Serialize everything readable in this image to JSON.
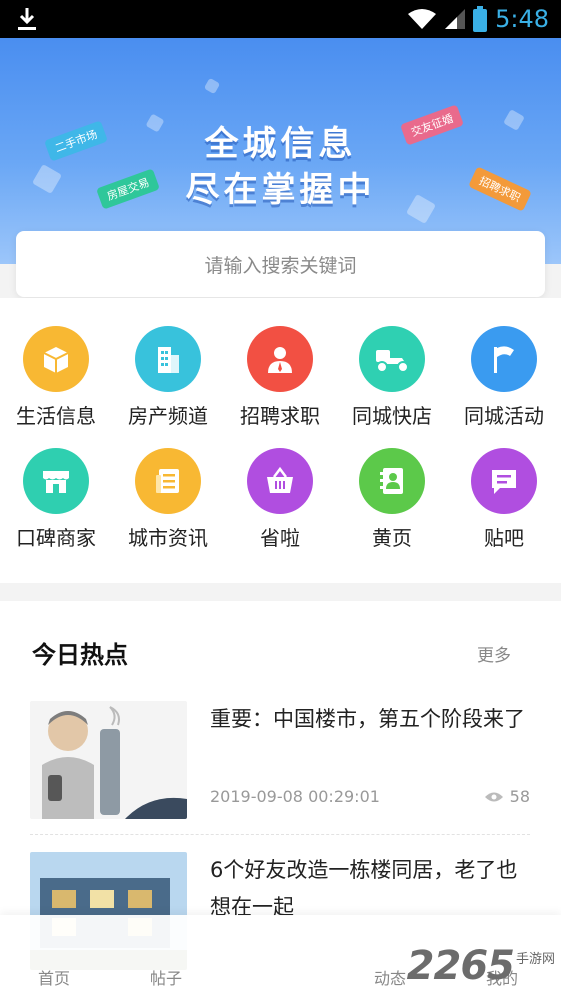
{
  "status_bar": {
    "time": "5:48"
  },
  "banner": {
    "line1": "全城信息",
    "line2": "尽在掌握中",
    "tags": [
      "二手市场",
      "房屋交易",
      "交友征婚",
      "招聘求职"
    ]
  },
  "search": {
    "placeholder": "请输入搜索关键词"
  },
  "categories": [
    {
      "label": "生活信息",
      "icon": "box-icon",
      "color": "#f8b833"
    },
    {
      "label": "房产频道",
      "icon": "building-icon",
      "color": "#38c2dc"
    },
    {
      "label": "招聘求职",
      "icon": "person-icon",
      "color": "#f25043"
    },
    {
      "label": "同城快店",
      "icon": "scooter-icon",
      "color": "#2fd0b2"
    },
    {
      "label": "同城活动",
      "icon": "flag-icon",
      "color": "#3a9bf0"
    },
    {
      "label": "口碑商家",
      "icon": "store-icon",
      "color": "#2fcfb0"
    },
    {
      "label": "城市资讯",
      "icon": "news-icon",
      "color": "#f8b833"
    },
    {
      "label": "省啦",
      "icon": "basket-icon",
      "color": "#b04ee0"
    },
    {
      "label": "黄页",
      "icon": "contact-book-icon",
      "color": "#5cc94a"
    },
    {
      "label": "贴吧",
      "icon": "chat-icon",
      "color": "#b04ee0"
    }
  ],
  "hot": {
    "title": "今日热点",
    "more": "更多",
    "articles": [
      {
        "title": "重要：中国楼市，第五个阶段来了",
        "date": "2019-09-08 00:29:01",
        "views": "58"
      },
      {
        "title": "6个好友改造一栋楼同居，老了也想在一起"
      }
    ]
  },
  "bottom_nav": {
    "items": [
      "首页",
      "帖子",
      "动态",
      "我的"
    ]
  },
  "watermark": {
    "brand": "2265",
    "suffix": "手游网"
  }
}
